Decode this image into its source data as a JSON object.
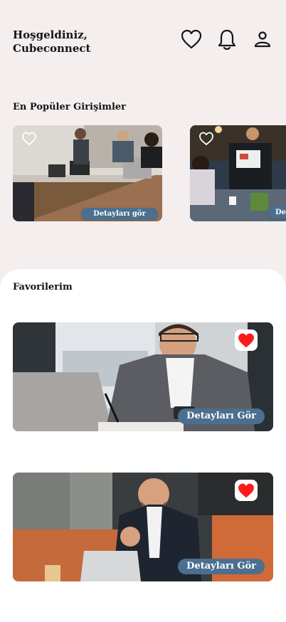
{
  "header": {
    "greeting_line1": "Hoşgeldiniz,",
    "greeting_line2": "Cubeconnect",
    "icons": [
      "heart-icon",
      "bell-icon",
      "user-icon"
    ]
  },
  "popular": {
    "title": "En Popüler Girişimler",
    "cards": [
      {
        "button_label": "Detayları gör",
        "favorited": false
      },
      {
        "button_label": "Detayları gör",
        "favorited": false
      }
    ]
  },
  "favorites": {
    "title": "Favorilerim",
    "cards": [
      {
        "button_label": "Detayları Gör",
        "favorited": true
      },
      {
        "button_label": "Detayları Gör",
        "favorited": true
      }
    ]
  },
  "colors": {
    "background": "#f4eeee",
    "button": "#4b6f8f",
    "favorite_heart": "#ff1a1a"
  }
}
